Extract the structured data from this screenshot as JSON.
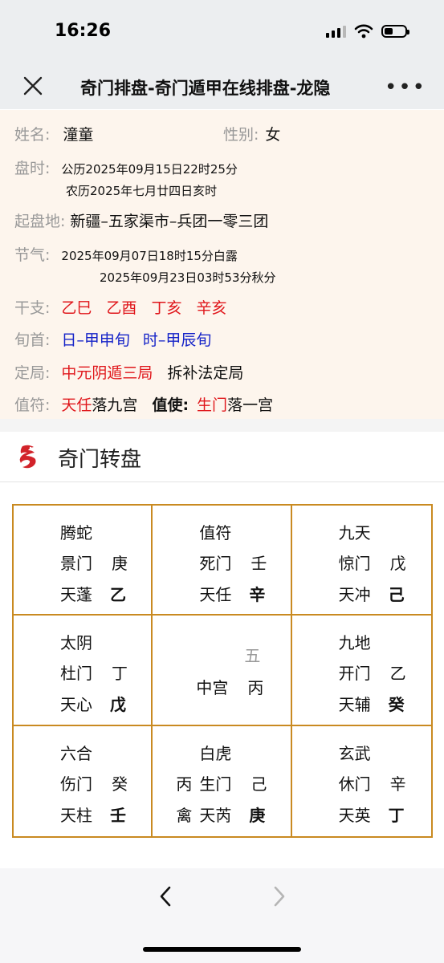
{
  "status": {
    "time": "16:26"
  },
  "nav": {
    "title": "奇门排盘-奇门遁甲在线排盘-龙隐"
  },
  "info": {
    "name_label": "姓名:",
    "name": "潼童",
    "gender_label": "性别:",
    "gender": "女",
    "time_label": "盘时:",
    "solar": "公历2025年09月15日22时25分",
    "lunar": "农历2025年七月廿四日亥时",
    "place_label": "起盘地:",
    "place": "新疆–五家渠市–兵团一零三团",
    "term_label": "节气:",
    "term1": "2025年09月07日18时15分白露",
    "term2": "2025年09月23日03时53分秋分",
    "ganzhi_label": "干支:",
    "ganzhi": [
      "乙巳",
      "乙酉",
      "丁亥",
      "辛亥"
    ],
    "xunshou_label": "旬首:",
    "xunshou_day": "日–甲申旬",
    "xunshou_hour": "时–甲辰旬",
    "ju_label": "定局:",
    "ju": "中元阴遁三局",
    "ju_method": "拆补法定局",
    "zhifu_label": "值符:",
    "zhifu_star": "天任",
    "zhifu_text": "落九宫",
    "zhishi_label": "值使:",
    "zhishi_door": "生门",
    "zhishi_text": "落一宫"
  },
  "section": {
    "title": "奇门转盘"
  },
  "palaces": [
    {
      "god": "腾蛇",
      "door": "景门",
      "door_stem": "庚",
      "star": "天蓬",
      "star_stem": "乙"
    },
    {
      "god": "值符",
      "door": "死门",
      "door_stem": "壬",
      "star": "天任",
      "star_stem": "辛"
    },
    {
      "god": "九天",
      "door": "惊门",
      "door_stem": "戊",
      "star": "天冲",
      "star_stem": "己"
    },
    {
      "god": "太阴",
      "door": "杜门",
      "door_stem": "丁",
      "star": "天心",
      "star_stem": "戊"
    },
    {
      "number": "五",
      "name": "中宫",
      "stem": "丙"
    },
    {
      "god": "九地",
      "door": "开门",
      "door_stem": "乙",
      "star": "天辅",
      "star_stem": "癸"
    },
    {
      "god": "六合",
      "door": "伤门",
      "door_stem": "癸",
      "star": "天柱",
      "star_stem": "壬"
    },
    {
      "god": "白虎",
      "door_prefix": "丙",
      "door": "生门",
      "door_stem": "己",
      "star_prefix": "禽",
      "star": "天芮",
      "star_stem": "庚"
    },
    {
      "god": "玄武",
      "door": "休门",
      "door_stem": "辛",
      "star": "天英",
      "star_stem": "丁"
    }
  ],
  "icons": {
    "close": "close-icon",
    "more": "more-icon",
    "back": "chevron-left-icon",
    "forward": "chevron-right-icon",
    "section": "dragon-logo-icon"
  },
  "colors": {
    "accent_red": "#e0161b",
    "accent_blue": "#1523c8",
    "grid_border": "#c98a21",
    "info_bg": "#fdf5ed"
  }
}
